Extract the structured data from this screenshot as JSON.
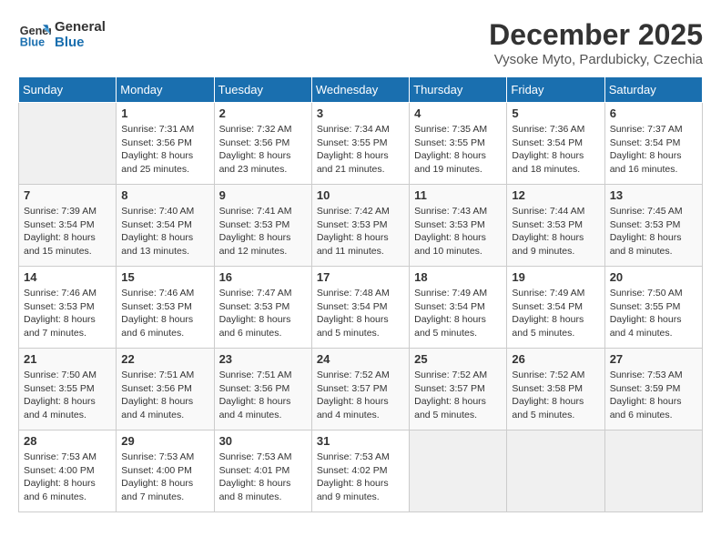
{
  "logo": {
    "line1": "General",
    "line2": "Blue"
  },
  "title": "December 2025",
  "subtitle": "Vysoke Myto, Pardubicky, Czechia",
  "weekdays": [
    "Sunday",
    "Monday",
    "Tuesday",
    "Wednesday",
    "Thursday",
    "Friday",
    "Saturday"
  ],
  "weeks": [
    [
      {
        "day": null
      },
      {
        "day": 1,
        "sunrise": "7:31 AM",
        "sunset": "3:56 PM",
        "daylight": "8 hours and 25 minutes."
      },
      {
        "day": 2,
        "sunrise": "7:32 AM",
        "sunset": "3:56 PM",
        "daylight": "8 hours and 23 minutes."
      },
      {
        "day": 3,
        "sunrise": "7:34 AM",
        "sunset": "3:55 PM",
        "daylight": "8 hours and 21 minutes."
      },
      {
        "day": 4,
        "sunrise": "7:35 AM",
        "sunset": "3:55 PM",
        "daylight": "8 hours and 19 minutes."
      },
      {
        "day": 5,
        "sunrise": "7:36 AM",
        "sunset": "3:54 PM",
        "daylight": "8 hours and 18 minutes."
      },
      {
        "day": 6,
        "sunrise": "7:37 AM",
        "sunset": "3:54 PM",
        "daylight": "8 hours and 16 minutes."
      }
    ],
    [
      {
        "day": 7,
        "sunrise": "7:39 AM",
        "sunset": "3:54 PM",
        "daylight": "8 hours and 15 minutes."
      },
      {
        "day": 8,
        "sunrise": "7:40 AM",
        "sunset": "3:54 PM",
        "daylight": "8 hours and 13 minutes."
      },
      {
        "day": 9,
        "sunrise": "7:41 AM",
        "sunset": "3:53 PM",
        "daylight": "8 hours and 12 minutes."
      },
      {
        "day": 10,
        "sunrise": "7:42 AM",
        "sunset": "3:53 PM",
        "daylight": "8 hours and 11 minutes."
      },
      {
        "day": 11,
        "sunrise": "7:43 AM",
        "sunset": "3:53 PM",
        "daylight": "8 hours and 10 minutes."
      },
      {
        "day": 12,
        "sunrise": "7:44 AM",
        "sunset": "3:53 PM",
        "daylight": "8 hours and 9 minutes."
      },
      {
        "day": 13,
        "sunrise": "7:45 AM",
        "sunset": "3:53 PM",
        "daylight": "8 hours and 8 minutes."
      }
    ],
    [
      {
        "day": 14,
        "sunrise": "7:46 AM",
        "sunset": "3:53 PM",
        "daylight": "8 hours and 7 minutes."
      },
      {
        "day": 15,
        "sunrise": "7:46 AM",
        "sunset": "3:53 PM",
        "daylight": "8 hours and 6 minutes."
      },
      {
        "day": 16,
        "sunrise": "7:47 AM",
        "sunset": "3:53 PM",
        "daylight": "8 hours and 6 minutes."
      },
      {
        "day": 17,
        "sunrise": "7:48 AM",
        "sunset": "3:54 PM",
        "daylight": "8 hours and 5 minutes."
      },
      {
        "day": 18,
        "sunrise": "7:49 AM",
        "sunset": "3:54 PM",
        "daylight": "8 hours and 5 minutes."
      },
      {
        "day": 19,
        "sunrise": "7:49 AM",
        "sunset": "3:54 PM",
        "daylight": "8 hours and 5 minutes."
      },
      {
        "day": 20,
        "sunrise": "7:50 AM",
        "sunset": "3:55 PM",
        "daylight": "8 hours and 4 minutes."
      }
    ],
    [
      {
        "day": 21,
        "sunrise": "7:50 AM",
        "sunset": "3:55 PM",
        "daylight": "8 hours and 4 minutes."
      },
      {
        "day": 22,
        "sunrise": "7:51 AM",
        "sunset": "3:56 PM",
        "daylight": "8 hours and 4 minutes."
      },
      {
        "day": 23,
        "sunrise": "7:51 AM",
        "sunset": "3:56 PM",
        "daylight": "8 hours and 4 minutes."
      },
      {
        "day": 24,
        "sunrise": "7:52 AM",
        "sunset": "3:57 PM",
        "daylight": "8 hours and 4 minutes."
      },
      {
        "day": 25,
        "sunrise": "7:52 AM",
        "sunset": "3:57 PM",
        "daylight": "8 hours and 5 minutes."
      },
      {
        "day": 26,
        "sunrise": "7:52 AM",
        "sunset": "3:58 PM",
        "daylight": "8 hours and 5 minutes."
      },
      {
        "day": 27,
        "sunrise": "7:53 AM",
        "sunset": "3:59 PM",
        "daylight": "8 hours and 6 minutes."
      }
    ],
    [
      {
        "day": 28,
        "sunrise": "7:53 AM",
        "sunset": "4:00 PM",
        "daylight": "8 hours and 6 minutes."
      },
      {
        "day": 29,
        "sunrise": "7:53 AM",
        "sunset": "4:00 PM",
        "daylight": "8 hours and 7 minutes."
      },
      {
        "day": 30,
        "sunrise": "7:53 AM",
        "sunset": "4:01 PM",
        "daylight": "8 hours and 8 minutes."
      },
      {
        "day": 31,
        "sunrise": "7:53 AM",
        "sunset": "4:02 PM",
        "daylight": "8 hours and 9 minutes."
      },
      {
        "day": null
      },
      {
        "day": null
      },
      {
        "day": null
      }
    ]
  ],
  "labels": {
    "sunrise": "Sunrise:",
    "sunset": "Sunset:",
    "daylight": "Daylight:"
  }
}
